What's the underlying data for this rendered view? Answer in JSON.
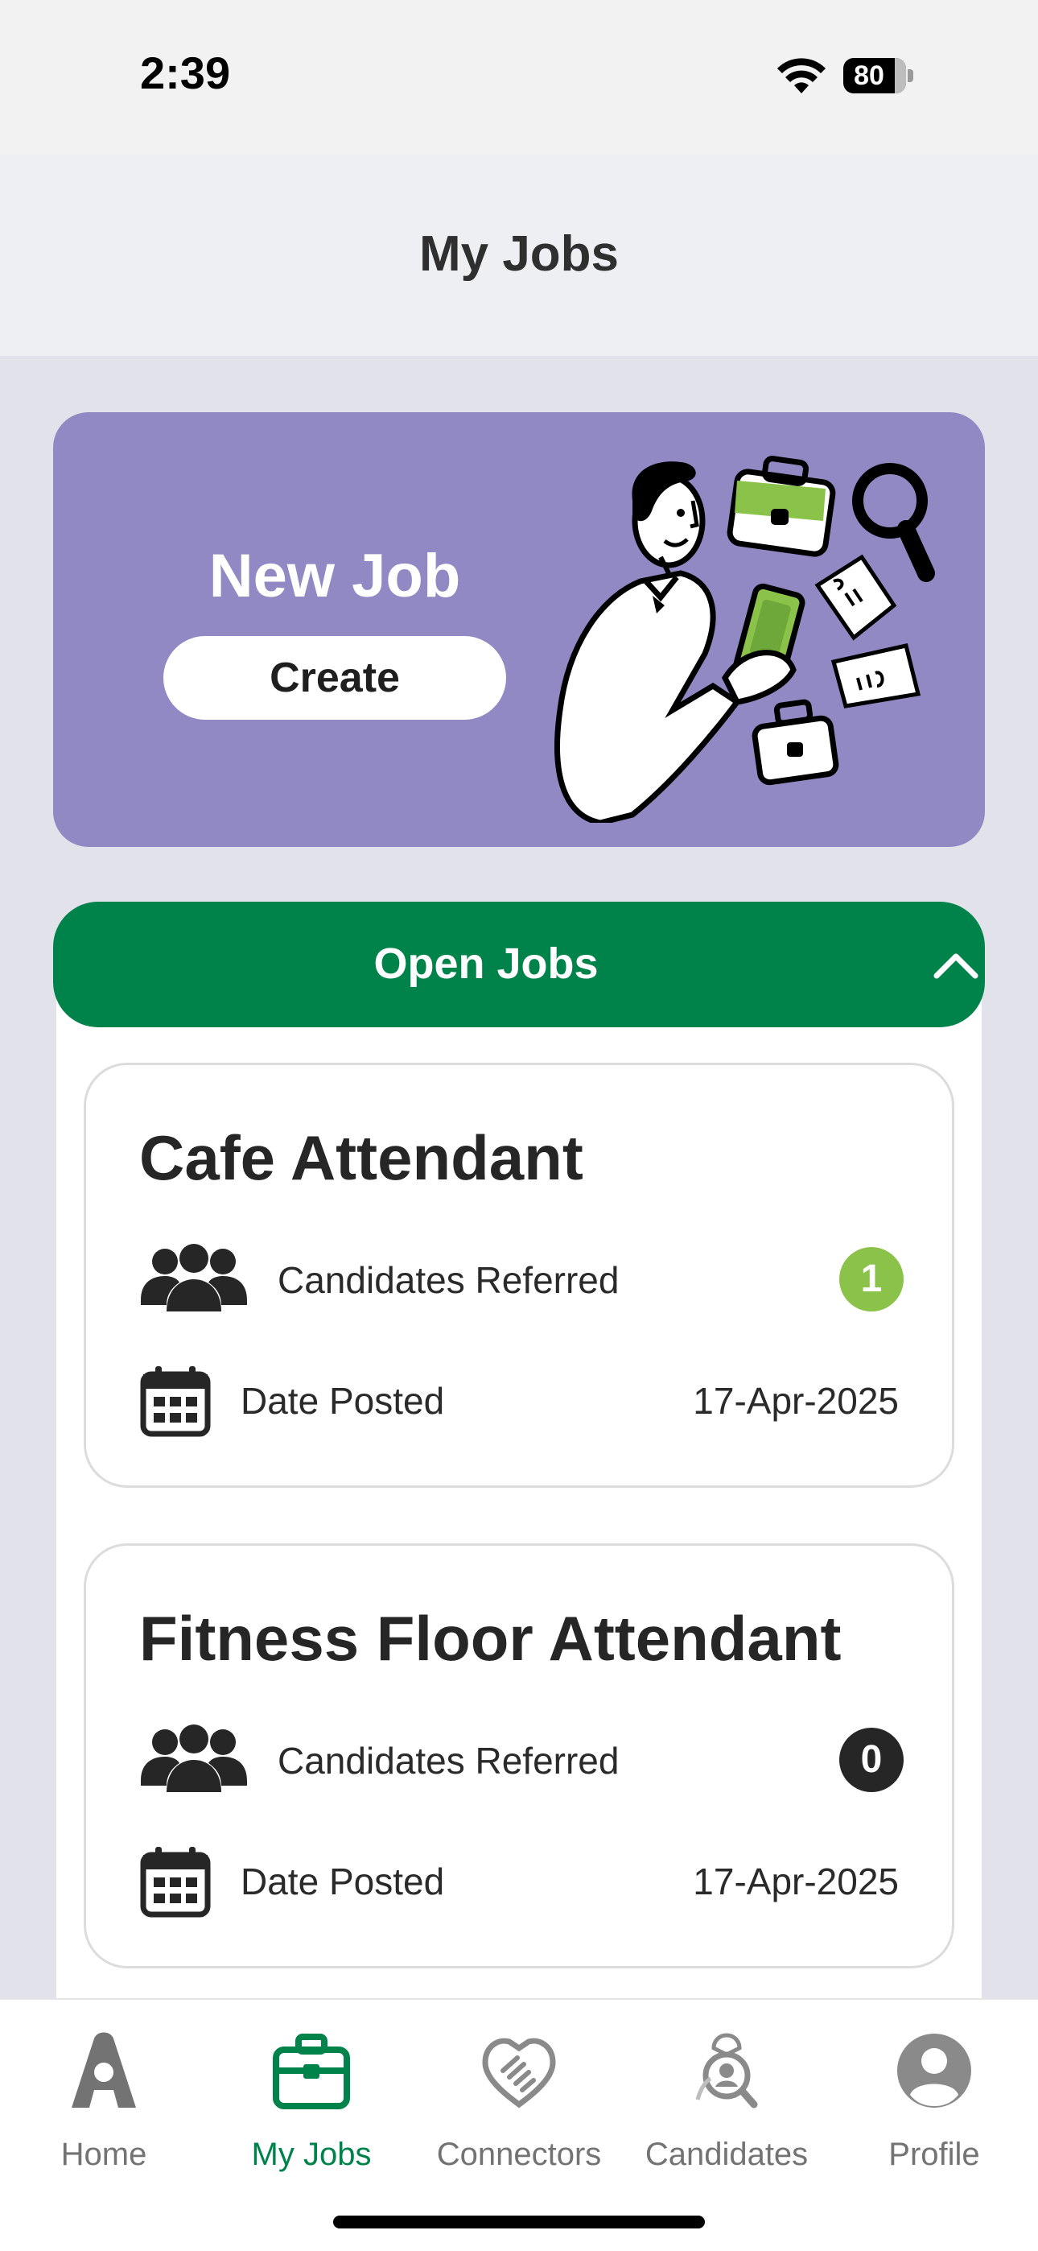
{
  "status_bar": {
    "time": "2:39",
    "battery": "80"
  },
  "header": {
    "title": "My Jobs"
  },
  "banner": {
    "title": "New Job",
    "create_label": "Create"
  },
  "open_jobs": {
    "title": "Open Jobs",
    "jobs": [
      {
        "title": "Cafe Attendant",
        "candidates_label": "Candidates Referred",
        "candidates_count": "1",
        "badge_color": "#8BC34A",
        "date_label": "Date Posted",
        "date": "17-Apr-2025"
      },
      {
        "title": "Fitness Floor Attendant",
        "candidates_label": "Candidates Referred",
        "candidates_count": "0",
        "badge_color": "#262626",
        "date_label": "Date Posted",
        "date": "17-Apr-2025"
      }
    ]
  },
  "tab_bar": {
    "tabs": [
      {
        "label": "Home",
        "icon": "home-logo-icon"
      },
      {
        "label": "My Jobs",
        "icon": "briefcase-icon",
        "active": true
      },
      {
        "label": "Connectors",
        "icon": "handshake-icon"
      },
      {
        "label": "Candidates",
        "icon": "candidate-search-icon"
      },
      {
        "label": "Profile",
        "icon": "profile-icon"
      }
    ]
  },
  "colors": {
    "primary_green": "#00834A",
    "banner_purple": "#9189C3",
    "badge_green": "#8BC34A"
  }
}
